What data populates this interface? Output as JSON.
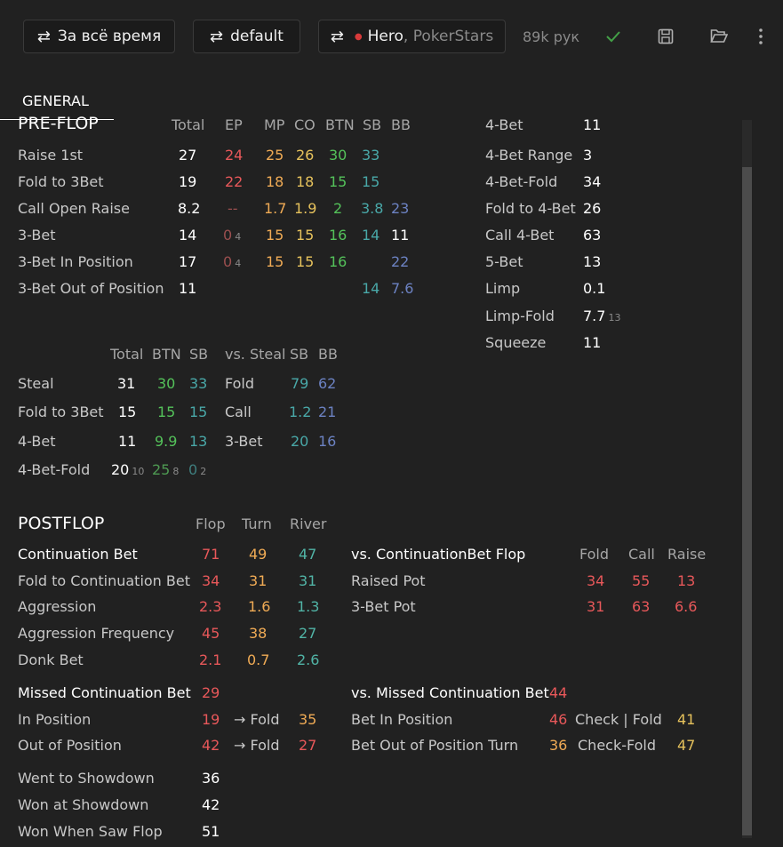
{
  "toolbar": {
    "period": "За всё время",
    "filter": "default",
    "player": "Hero",
    "site": "PokerStars",
    "hands": "89k рук"
  },
  "tab": "GENERAL",
  "preflop": {
    "title": "PRE-FLOP",
    "headers": [
      "Total",
      "EP",
      "MP",
      "CO",
      "BTN",
      "SB",
      "BB"
    ],
    "rows": [
      {
        "label": "Raise 1st",
        "total": "27",
        "ep": "24",
        "mp": "25",
        "co": "26",
        "btn": "30",
        "sb": "33",
        "bb": ""
      },
      {
        "label": "Fold to 3Bet",
        "total": "19",
        "ep": "22",
        "mp": "18",
        "co": "18",
        "btn": "15",
        "sb": "15",
        "bb": ""
      },
      {
        "label": "Call Open Raise",
        "total": "8.2",
        "ep": "--",
        "mp": "1.7",
        "co": "1.9",
        "btn": "2",
        "sb": "3.8",
        "bb": "23"
      },
      {
        "label": "3-Bet",
        "total": "14",
        "ep": "0",
        "ep_n": "4",
        "mp": "15",
        "co": "15",
        "btn": "16",
        "sb": "14",
        "bb": "11"
      },
      {
        "label": "3-Bet In Position",
        "total": "17",
        "ep": "0",
        "ep_n": "4",
        "mp": "15",
        "co": "15",
        "btn": "16",
        "sb": "",
        "bb": "22"
      },
      {
        "label": "3-Bet Out of Position",
        "total": "11",
        "ep": "",
        "mp": "",
        "co": "",
        "btn": "",
        "sb": "14",
        "bb": "7.6"
      }
    ],
    "right": [
      {
        "label": "4-Bet",
        "value": "11"
      },
      {
        "label": "4-Bet Range",
        "value": "3"
      },
      {
        "label": "4-Bet-Fold",
        "value": "34"
      },
      {
        "label": "Fold to 4-Bet",
        "value": "26"
      },
      {
        "label": "Call 4-Bet",
        "value": "63"
      },
      {
        "label": "5-Bet",
        "value": "13"
      },
      {
        "label": "Limp",
        "value": "0.1"
      },
      {
        "label": "Limp-Fold",
        "value": "7.7",
        "n": "13"
      },
      {
        "label": "Squeeze",
        "value": "11"
      }
    ]
  },
  "steal": {
    "headers": [
      "Total",
      "BTN",
      "SB"
    ],
    "rows": [
      {
        "label": "Steal",
        "total": "31",
        "btn": "30",
        "sb": "33"
      },
      {
        "label": "Fold to 3Bet",
        "total": "15",
        "btn": "15",
        "sb": "15"
      },
      {
        "label": "4-Bet",
        "total": "11",
        "btn": "9.9",
        "sb": "13"
      },
      {
        "label": "4-Bet-Fold",
        "total": "20",
        "total_n": "10",
        "btn": "25",
        "btn_n": "8",
        "sb": "0",
        "sb_n": "2"
      }
    ],
    "vs_headers": [
      "vs. Steal",
      "SB",
      "BB"
    ],
    "vs_rows": [
      {
        "label": "Fold",
        "sb": "79",
        "bb": "62"
      },
      {
        "label": "Call",
        "sb": "1.2",
        "bb": "21"
      },
      {
        "label": "3-Bet",
        "sb": "20",
        "bb": "16"
      }
    ]
  },
  "postflop": {
    "title": "POSTFLOP",
    "headers": [
      "Flop",
      "Turn",
      "River"
    ],
    "rows": [
      {
        "label": "Continuation Bet",
        "flop": "71",
        "turn": "49",
        "river": "47"
      },
      {
        "label": "Fold to Continuation Bet",
        "flop": "34",
        "turn": "31",
        "river": "31"
      },
      {
        "label": "Aggression",
        "flop": "2.3",
        "turn": "1.6",
        "river": "1.3"
      },
      {
        "label": "Aggression Frequency",
        "flop": "45",
        "turn": "38",
        "river": "27"
      },
      {
        "label": "Donk Bet",
        "flop": "2.1",
        "turn": "0.7",
        "river": "2.6"
      }
    ],
    "vs_cbet": {
      "title": "vs. ContinuationBet Flop",
      "headers": [
        "Fold",
        "Call",
        "Raise"
      ],
      "rows": [
        {
          "label": "Raised Pot",
          "fold": "34",
          "call": "55",
          "raise": "13"
        },
        {
          "label": "3-Bet Pot",
          "fold": "31",
          "call": "63",
          "raise": "6.6"
        }
      ]
    },
    "missed": {
      "title": "Missed Continuation Bet",
      "value": "29",
      "rows": [
        {
          "label": "In Position",
          "value": "19",
          "arrow": "→ Fold",
          "fold": "35"
        },
        {
          "label": "Out of Position",
          "value": "42",
          "arrow": "→ Fold",
          "fold": "27"
        }
      ]
    },
    "vs_missed": {
      "title": "vs. Missed Continuation Bet",
      "value": "44",
      "rows": [
        {
          "label": "Bet In Position",
          "value": "46",
          "action": "Check | Fold",
          "action_value": "41"
        },
        {
          "label": "Bet Out of Position Turn",
          "value": "36",
          "action": "Check-Fold",
          "action_value": "47"
        }
      ]
    },
    "showdown": [
      {
        "label": "Went to Showdown",
        "value": "36"
      },
      {
        "label": "Won at Showdown",
        "value": "42"
      },
      {
        "label": "Won When Saw Flop",
        "value": "51"
      }
    ]
  }
}
